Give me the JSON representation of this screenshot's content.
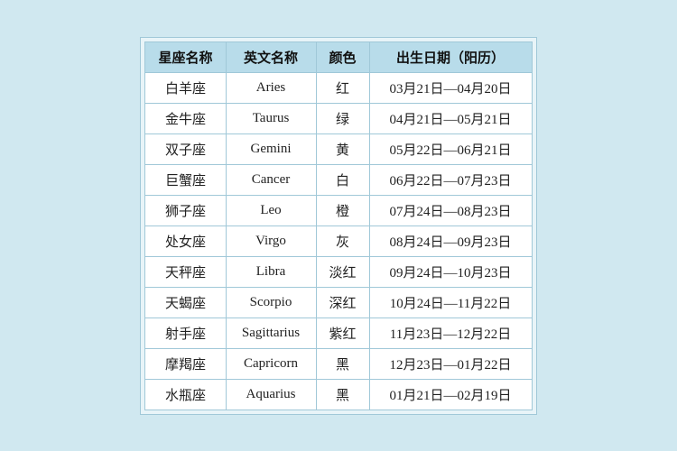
{
  "table": {
    "headers": [
      "星座名称",
      "英文名称",
      "颜色",
      "出生日期（阳历）"
    ],
    "rows": [
      {
        "zh_name": "白羊座",
        "en_name": "Aries",
        "color": "红",
        "dates": "03月21日—04月20日"
      },
      {
        "zh_name": "金牛座",
        "en_name": "Taurus",
        "color": "绿",
        "dates": "04月21日—05月21日"
      },
      {
        "zh_name": "双子座",
        "en_name": "Gemini",
        "color": "黄",
        "dates": "05月22日—06月21日"
      },
      {
        "zh_name": "巨蟹座",
        "en_name": "Cancer",
        "color": "白",
        "dates": "06月22日—07月23日"
      },
      {
        "zh_name": "狮子座",
        "en_name": "Leo",
        "color": "橙",
        "dates": "07月24日—08月23日"
      },
      {
        "zh_name": "处女座",
        "en_name": "Virgo",
        "color": "灰",
        "dates": "08月24日—09月23日"
      },
      {
        "zh_name": "天秤座",
        "en_name": "Libra",
        "color": "淡红",
        "dates": "09月24日—10月23日"
      },
      {
        "zh_name": "天蝎座",
        "en_name": "Scorpio",
        "color": "深红",
        "dates": "10月24日—11月22日"
      },
      {
        "zh_name": "射手座",
        "en_name": "Sagittarius",
        "color": "紫红",
        "dates": "11月23日—12月22日"
      },
      {
        "zh_name": "摩羯座",
        "en_name": "Capricorn",
        "color": "黑",
        "dates": "12月23日—01月22日"
      },
      {
        "zh_name": "水瓶座",
        "en_name": "Aquarius",
        "color": "黑",
        "dates": "01月21日—02月19日"
      }
    ]
  }
}
